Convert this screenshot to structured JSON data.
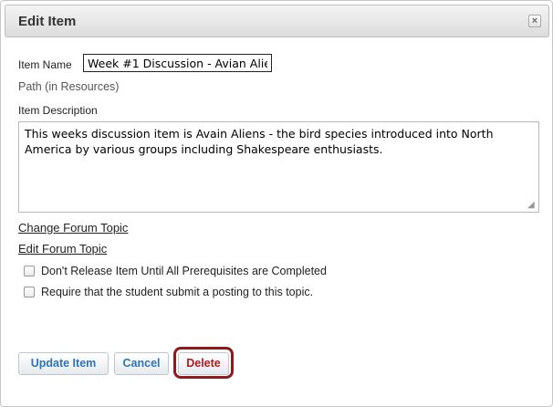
{
  "dialog": {
    "title": "Edit Item",
    "close_icon": "close-x-icon"
  },
  "form": {
    "item_name_label": "Item Name",
    "item_name_value": "Week #1 Discussion - Avian Alie",
    "path_label": "Path (in Resources)",
    "description_label": "Item Description",
    "description_value": "This weeks discussion item is Avain Aliens - the bird species introduced into North America by various groups including Shakespeare enthusiasts."
  },
  "links": {
    "change_forum_topic": "Change Forum Topic",
    "edit_forum_topic": "Edit Forum Topic"
  },
  "options": [
    {
      "label": "Don't Release Item Until All Prerequisites are Completed",
      "checked": false
    },
    {
      "label": "Require that the student submit a posting to this topic.",
      "checked": false
    }
  ],
  "buttons": {
    "update": "Update Item",
    "cancel": "Cancel",
    "delete": "Delete"
  },
  "colors": {
    "primary_button_text": "#2e75b6",
    "delete_text": "#b01c1c",
    "delete_highlight": "#8e1b1b"
  }
}
